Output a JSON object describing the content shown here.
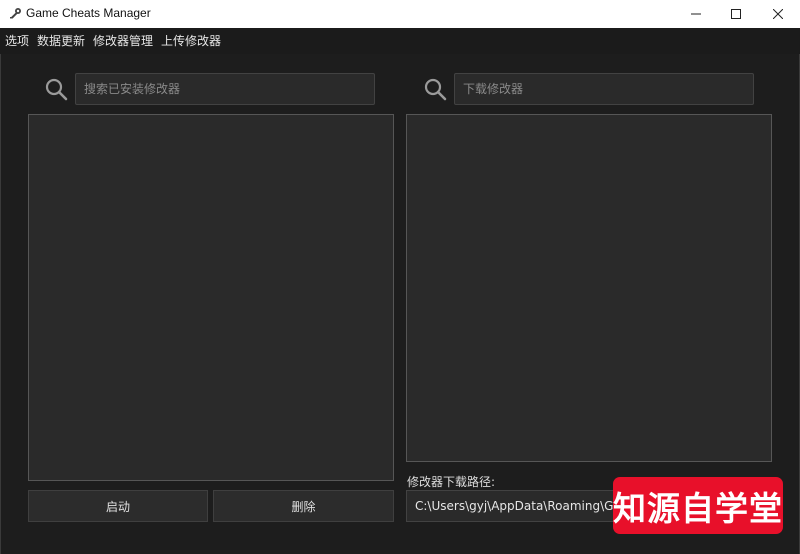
{
  "window": {
    "title": "Game Cheats Manager"
  },
  "menu": {
    "items": [
      "选项",
      "数据更新",
      "修改器管理",
      "上传修改器"
    ]
  },
  "installed": {
    "search_placeholder": "搜索已安装修改器",
    "launch_label": "启动",
    "delete_label": "删除"
  },
  "download": {
    "search_placeholder": "下载修改器",
    "path_label": "修改器下载路径:",
    "path_value": "C:\\Users\\gyj\\AppData\\Roaming\\GCM\\Trainers"
  },
  "watermark": {
    "text": "知源自学堂"
  },
  "colors": {
    "background": "#1d1d1d",
    "panel": "#2a2a2a",
    "watermark": "#e8102a"
  },
  "icons": {
    "app": "key-icon",
    "search": "search-icon",
    "minimize": "minimize-icon",
    "maximize": "maximize-icon",
    "close": "close-icon"
  }
}
